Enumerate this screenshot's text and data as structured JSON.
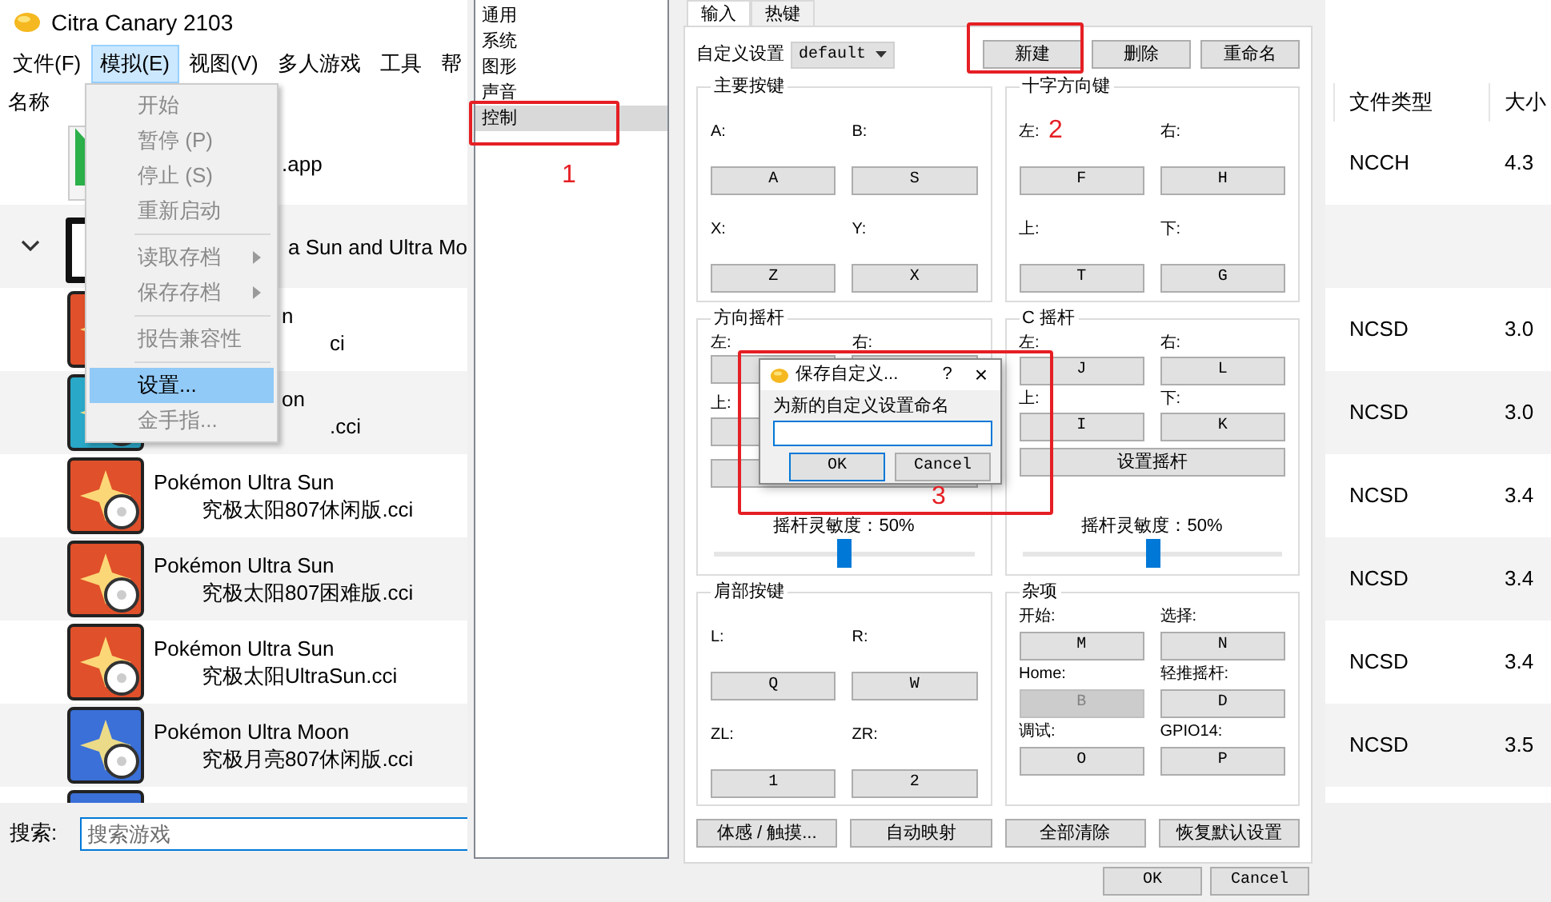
{
  "main_window": {
    "title": "Citra Canary 2103",
    "menu": [
      {
        "label": "文件(F)",
        "selected": false
      },
      {
        "label": "模拟(E)",
        "selected": true
      },
      {
        "label": "视图(V)",
        "selected": false
      },
      {
        "label": "多人游戏",
        "selected": false
      },
      {
        "label": "工具",
        "selected": false
      },
      {
        "label": "帮",
        "selected": false
      }
    ],
    "open_menu": [
      {
        "kind": "item",
        "label": "开始",
        "disabled": true,
        "selected": false,
        "submenu": false
      },
      {
        "kind": "item",
        "label": "暂停 (P)",
        "disabled": true,
        "selected": false,
        "submenu": false
      },
      {
        "kind": "item",
        "label": "停止 (S)",
        "disabled": true,
        "selected": false,
        "submenu": false
      },
      {
        "kind": "item",
        "label": "重新启动",
        "disabled": true,
        "selected": false,
        "submenu": false
      },
      {
        "kind": "separator"
      },
      {
        "kind": "item",
        "label": "读取存档",
        "disabled": true,
        "selected": false,
        "submenu": true
      },
      {
        "kind": "item",
        "label": "保存存档",
        "disabled": true,
        "selected": false,
        "submenu": true
      },
      {
        "kind": "separator"
      },
      {
        "kind": "item",
        "label": "报告兼容性",
        "disabled": true,
        "selected": false,
        "submenu": false
      },
      {
        "kind": "separator"
      },
      {
        "kind": "item",
        "label": "设置...",
        "disabled": false,
        "selected": true,
        "submenu": false
      },
      {
        "kind": "item",
        "label": "金手指...",
        "disabled": true,
        "selected": false,
        "submenu": false
      }
    ],
    "columns": [
      "名称",
      "文件类型",
      "大小"
    ],
    "rows": [
      {
        "kind": "app",
        "partly_hidden": true,
        "name": ".app",
        "file_type": "NCCH",
        "size": "4.3"
      },
      {
        "kind": "folder",
        "partly_hidden": true,
        "expanded": true,
        "name": "a Sun and Ultra Mo"
      },
      {
        "kind": "game",
        "partly_hidden": true,
        "color": "#e0502a",
        "name": "n",
        "file": "ci",
        "file_type": "NCSD",
        "size": "3.0"
      },
      {
        "kind": "game",
        "partly_hidden": true,
        "color": "#2aa8c8",
        "name": "on",
        "file": ".cci",
        "file_type": "NCSD",
        "size": "3.0"
      },
      {
        "kind": "game",
        "partly_hidden": false,
        "color": "#e0502a",
        "name": "Pokémon Ultra Sun",
        "file": "究极太阳807休闲版.cci",
        "file_type": "NCSD",
        "size": "3.4"
      },
      {
        "kind": "game",
        "partly_hidden": false,
        "color": "#e0502a",
        "name": "Pokémon Ultra Sun",
        "file": "究极太阳807困难版.cci",
        "file_type": "NCSD",
        "size": "3.4"
      },
      {
        "kind": "game",
        "partly_hidden": false,
        "color": "#e0502a",
        "name": "Pokémon Ultra Sun",
        "file": "究极太阳UltraSun.cci",
        "file_type": "NCSD",
        "size": "3.4"
      },
      {
        "kind": "game",
        "partly_hidden": false,
        "color": "#3a70d8",
        "name": "Pokémon Ultra Moon",
        "file": "究极月亮807休闲版.cci",
        "file_type": "NCSD",
        "size": "3.5"
      },
      {
        "kind": "game",
        "color": "#3a70d8"
      }
    ],
    "search": {
      "label": "搜索:",
      "placeholder": "搜索游戏"
    }
  },
  "settings_window": {
    "categories": [
      {
        "label": "通用",
        "selected": false
      },
      {
        "label": "系统",
        "selected": false
      },
      {
        "label": "图形",
        "selected": false
      },
      {
        "label": "声音",
        "selected": false
      },
      {
        "label": "控制",
        "selected": true
      }
    ],
    "tabs": [
      {
        "label": "输入",
        "selected": true
      },
      {
        "label": "热键",
        "selected": false
      }
    ],
    "profile_label": "自定义设置",
    "profile_value": "default",
    "profile_buttons": [
      "新建",
      "删除",
      "重命名"
    ],
    "groups": [
      {
        "kind": "buttons",
        "title": "主要按键",
        "bindings": [
          {
            "label": "A:",
            "key": "A"
          },
          {
            "label": "B:",
            "key": "S"
          },
          {
            "label": "X:",
            "key": "Z"
          },
          {
            "label": "Y:",
            "key": "X"
          }
        ]
      },
      {
        "kind": "buttons",
        "title": "十字方向键",
        "bindings": [
          {
            "label": "左:",
            "key": "F"
          },
          {
            "label": "右:",
            "key": "H"
          },
          {
            "label": "上:",
            "key": "T"
          },
          {
            "label": "下:",
            "key": "G"
          }
        ]
      },
      {
        "kind": "stick",
        "title": "方向摇杆",
        "bindings": [
          {
            "label": "左:"
          },
          {
            "label": "右:"
          },
          {
            "label": "上:"
          }
        ],
        "sensitivity": "摇杆灵敏度：50%",
        "level": 0.5
      },
      {
        "kind": "stick",
        "title": "C 摇杆",
        "bindings": [
          {
            "label": "左:",
            "key": "J"
          },
          {
            "label": "右:",
            "key": "L"
          },
          {
            "label": "上:",
            "key": "I"
          },
          {
            "label": "下:",
            "key": "K"
          }
        ],
        "stick_button": "设置摇杆",
        "sensitivity": "摇杆灵敏度：50%",
        "level": 0.5
      },
      {
        "kind": "buttons",
        "title": "肩部按键",
        "bindings": [
          {
            "label": "L:",
            "key": "Q"
          },
          {
            "label": "R:",
            "key": "W"
          },
          {
            "label": "ZL:",
            "key": "1"
          },
          {
            "label": "ZR:",
            "key": "2"
          }
        ]
      },
      {
        "kind": "buttons",
        "title": "杂项",
        "bindings": [
          {
            "label": "开始:",
            "key": "M",
            "disabled": false
          },
          {
            "label": "选择:",
            "key": "N",
            "disabled": false
          },
          {
            "label": "Home:",
            "key": "B",
            "disabled": true
          },
          {
            "label": "轻推摇杆:",
            "key": "D",
            "disabled": false
          },
          {
            "label": "调试:",
            "key": "O",
            "disabled": false
          },
          {
            "label": "GPIO14:",
            "key": "P",
            "disabled": false
          }
        ]
      }
    ],
    "bottom_buttons": [
      "体感 / 触摸...",
      "自动映射",
      "全部清除",
      "恢复默认设置"
    ],
    "dialog_buttons": [
      "OK",
      "Cancel"
    ],
    "dialog": {
      "title": "保存自定义...",
      "help": "?",
      "close": "×",
      "prompt": "为新的自定义设置命名",
      "buttons": [
        {
          "label": "OK",
          "selected": true
        },
        {
          "label": "Cancel",
          "selected": false
        }
      ]
    }
  },
  "annotations": [
    {
      "label": "1"
    },
    {
      "label": "2"
    },
    {
      "label": "3"
    }
  ]
}
